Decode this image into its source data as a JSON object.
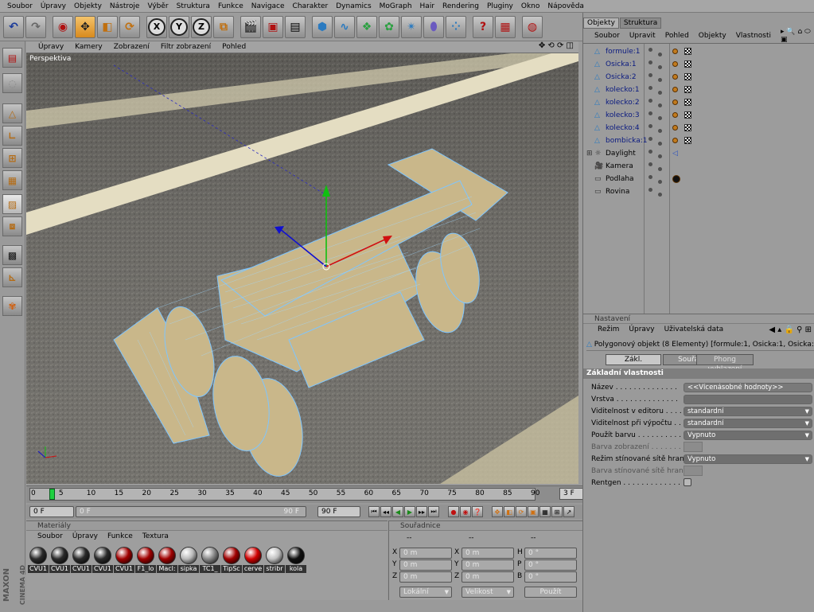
{
  "menu": [
    "Soubor",
    "Úpravy",
    "Objekty",
    "Nástroje",
    "Výběr",
    "Struktura",
    "Funkce",
    "Navigace",
    "Charakter",
    "Dynamics",
    "MoGraph",
    "Hair",
    "Rendering",
    "Pluginy",
    "Okno",
    "Nápověda"
  ],
  "axes": {
    "x": "X",
    "y": "Y",
    "z": "Z"
  },
  "viewport": {
    "menu": [
      "Úpravy",
      "Kamery",
      "Zobrazení",
      "Filtr zobrazení",
      "Pohled"
    ],
    "label": "Perspektiva"
  },
  "timeline": {
    "ticks": [
      "0",
      "5",
      "10",
      "15",
      "20",
      "25",
      "30",
      "35",
      "40",
      "45",
      "50",
      "55",
      "60",
      "65",
      "70",
      "75",
      "80",
      "85",
      "90"
    ],
    "current": "3 F",
    "current_fraction": 0.033,
    "start": "0 F",
    "range_start": "0 F",
    "range_end": "90 F",
    "end": "90 F"
  },
  "materials": {
    "title": "Materiály",
    "menu": [
      "Soubor",
      "Úpravy",
      "Funkce",
      "Textura"
    ],
    "items": [
      {
        "label": "CVU1",
        "color": "#2a2a2a"
      },
      {
        "label": "CVU1",
        "color": "#2a2a2a"
      },
      {
        "label": "CVU1",
        "color": "#2a2a2a"
      },
      {
        "label": "CVU1",
        "color": "#2a2a2a"
      },
      {
        "label": "CVU1",
        "color": "#a00000"
      },
      {
        "label": "F1_lo",
        "color": "#a00000"
      },
      {
        "label": "Macl:",
        "color": "#a00000"
      },
      {
        "label": "sipka",
        "color": "#b8b8b8"
      },
      {
        "label": "TC1_",
        "color": "#888888"
      },
      {
        "label": "TipSc",
        "color": "#a00000"
      },
      {
        "label": "cerve",
        "color": "#d00000"
      },
      {
        "label": "stribr",
        "color": "#c0c0c0"
      },
      {
        "label": "kola",
        "color": "#101010"
      }
    ]
  },
  "coords": {
    "title": "Souřadnice",
    "dash1": "--",
    "dash2": "--",
    "dash3": "--",
    "labels_pos": [
      "X",
      "Y",
      "Z"
    ],
    "labels_size": [
      "X",
      "Y",
      "Z"
    ],
    "labels_rot": [
      "H",
      "P",
      "B"
    ],
    "pos": [
      "0 m",
      "0 m",
      "0 m"
    ],
    "size": [
      "0 m",
      "0 m",
      "0 m"
    ],
    "rot": [
      "0 °",
      "0 °",
      "0 °"
    ],
    "mode": "Lokální",
    "size_mode": "Velikost",
    "apply": "Použít"
  },
  "objects": {
    "tabs": [
      "Objekty",
      "Struktura"
    ],
    "menu": [
      "Soubor",
      "Upravit",
      "Pohled",
      "Objekty",
      "Vlastnosti"
    ],
    "items": [
      "formule:1",
      "Osicka:1",
      "Osicka:2",
      "kolecko:1",
      "kolecko:2",
      "kolecko:3",
      "kolecko:4",
      "bombicka:1",
      "Daylight",
      "Kamera",
      "Podlaha",
      "Rovina"
    ]
  },
  "attributes": {
    "title": "Nastavení",
    "menu": [
      "Režim",
      "Úpravy",
      "Uživatelská data"
    ],
    "object_line": "Polygonový objekt (8 Elementy) [formule:1, Osicka:1, Osicka:2, kolecko",
    "tabs": [
      "Zákl.",
      "Souřad",
      "Phong vyhlazení"
    ],
    "section": "Základní vlastnosti",
    "rows": [
      {
        "label": "Název . . . . . . . . . . . . . .",
        "value": "<<Vícenásobné hodnoty>>"
      },
      {
        "label": "Vrstva . . . . . . . . . . . . . .",
        "value": ""
      },
      {
        "label": "Viditelnost v editoru . . . . .",
        "value": "standardní"
      },
      {
        "label": "Viditelnost při výpočtu . . .",
        "value": "standardní"
      },
      {
        "label": "Použít barvu . . . . . . . . . .",
        "value": "Vypnuto"
      },
      {
        "label": "Barva zobrazení . . . . . . . .",
        "value": ""
      },
      {
        "label": "Režim stínované sítě hran . .",
        "value": "Vypnuto"
      },
      {
        "label": "Barva stínované sítě hran . .",
        "value": ""
      },
      {
        "label": "Rentgen . . . . . . . . . . . . .",
        "value": ""
      }
    ]
  },
  "brand": {
    "line1": "MAXON",
    "line2": "CINEMA 4D"
  }
}
